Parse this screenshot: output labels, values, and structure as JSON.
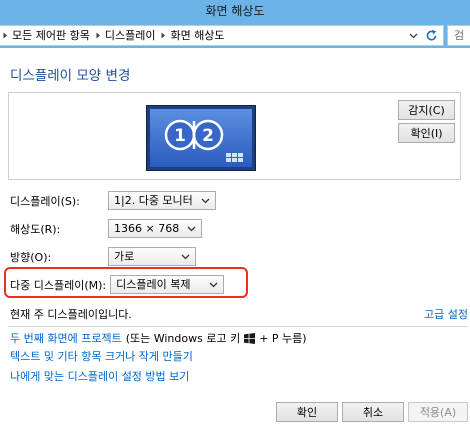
{
  "window": {
    "title": "화면 해상도"
  },
  "address_bar": {
    "breadcrumb": [
      "모든 제어판 항목",
      "디스플레이",
      "화면 해상도"
    ],
    "search_placeholder": "검"
  },
  "main": {
    "heading": "디스플레이 모양 변경",
    "preview": {
      "monitors": [
        "1",
        "2"
      ]
    },
    "detect_button": "감지(C)",
    "identify_button": "확인(I)",
    "fields": {
      "display": {
        "label": "디스플레이(S):",
        "value": "1|2. 다중 모니터"
      },
      "resolution": {
        "label": "해상도(R):",
        "value": "1366 × 768"
      },
      "orientation": {
        "label": "방향(O):",
        "value": "가로"
      },
      "multiple_displays": {
        "label": "다중 디스플레이(M):",
        "value": "디스플레이 복제"
      }
    },
    "status": "현재 주 디스플레이입니다.",
    "advanced_link": "고급 설정",
    "links": {
      "project": {
        "link": "두 번째 화면에 프로젝트",
        "note_before_icon": "(또는 Windows 로고 키",
        "note_after_icon": "+ P 누름)"
      },
      "text_size": "텍스트 및 기타 항목 크거나 작게 만들기",
      "help": "나에게 맞는 디스플레이 설정 방법 보기"
    }
  },
  "footer": {
    "ok": "확인",
    "cancel": "취소",
    "apply": "적용(A)"
  },
  "state": {
    "apply_enabled": false,
    "multiple_displays_highlighted": true
  },
  "colors": {
    "accent": "#6cb4e8",
    "heading": "#1e4fa0",
    "link": "#0066cc",
    "highlight": "#e8321e",
    "disabled_text": "#8c8c8c",
    "monitor_screen": "#3566c8"
  },
  "icons": {
    "breadcrumb_separator": "breadcrumb-separator-icon",
    "address_dropdown": "chevron-down-icon",
    "refresh": "refresh-icon",
    "combo_dropdown": "chevron-down-icon",
    "windows_logo": "windows-logo-icon"
  }
}
